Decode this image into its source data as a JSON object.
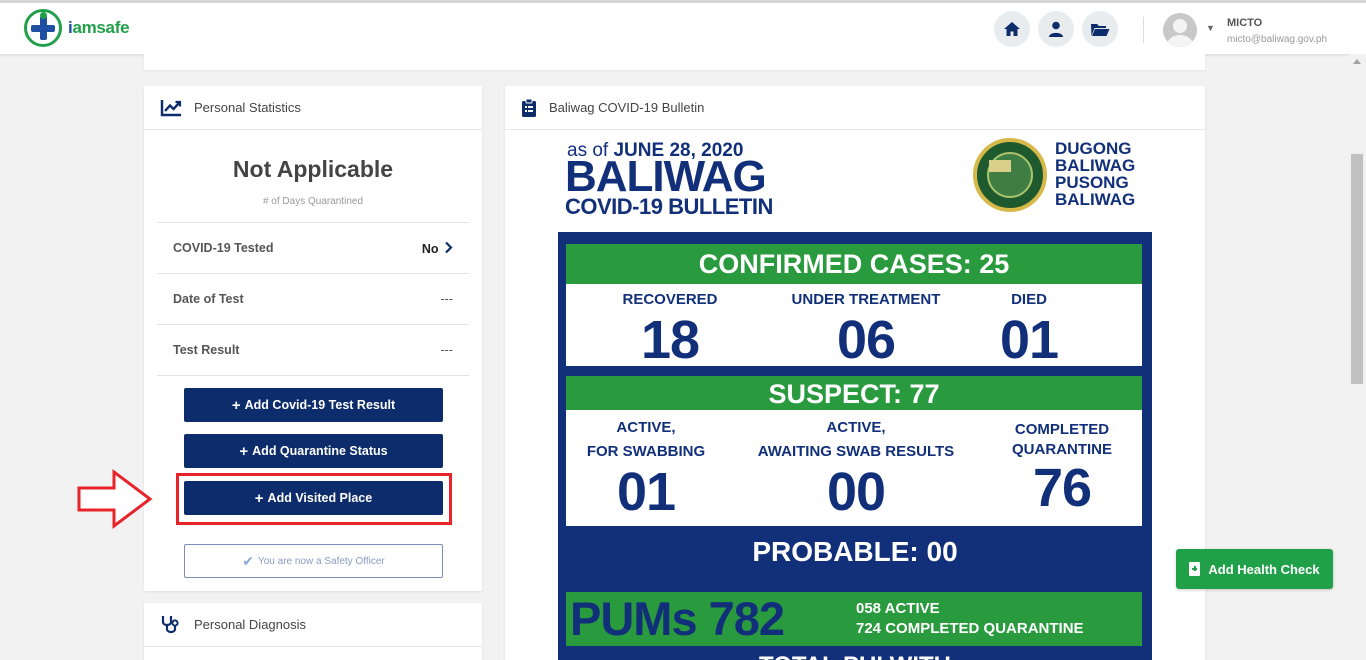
{
  "app": {
    "logo_text_a": "i",
    "logo_text_b": "amsafe"
  },
  "header": {
    "nav_icons": [
      "home-icon",
      "user-icon",
      "folder-icon"
    ],
    "user_name": "MICTO",
    "user_email": "micto@baliwag.gov.ph"
  },
  "stats_card": {
    "title": "Personal Statistics",
    "big_value": "Not Applicable",
    "big_caption": "# of Days Quarantined",
    "rows": [
      {
        "label": "COVID-19 Tested",
        "value": "No"
      },
      {
        "label": "Date of Test",
        "value": "---"
      },
      {
        "label": "Test Result",
        "value": "---"
      }
    ],
    "buttons": {
      "add_test_result": "Add Covid-19 Test Result",
      "add_quarantine": "Add Quarantine Status",
      "add_visited_place": "Add Visited Place",
      "safety_officer": "You are now a Safety Officer"
    }
  },
  "diagnosis_card": {
    "title": "Personal Diagnosis"
  },
  "bulletin_card": {
    "title": "Baliwag COVID-19 Bulletin",
    "graphic": {
      "as_of_prefix": "as of",
      "as_of_date": "JUNE 28, 2020",
      "town": "BALIWAG",
      "subtitle": "COVID-19 BULLETIN",
      "slogan": [
        "DUGONG",
        "BALIWAG",
        "PUSONG",
        "BALIWAG"
      ],
      "confirmed": "CONFIRMED CASES: 25",
      "confirmed_cols": [
        {
          "label": "RECOVERED",
          "value": "18"
        },
        {
          "label": "UNDER TREATMENT",
          "value": "06"
        },
        {
          "label": "DIED",
          "value": "01"
        }
      ],
      "suspect": "SUSPECT: 77",
      "suspect_cols": [
        {
          "label1": "ACTIVE,",
          "label2": "FOR SWABBING",
          "value": "01"
        },
        {
          "label1": "ACTIVE,",
          "label2": "AWAITING SWAB RESULTS",
          "value": "00"
        },
        {
          "label1": "COMPLETED",
          "label2": "QUARANTINE",
          "value": "76"
        }
      ],
      "probable": "PROBABLE: 00",
      "pums": "PUMs 782",
      "pums_active": "058  ACTIVE",
      "pums_completed": "724  COMPLETED QUARANTINE",
      "total_pui": "TOTAL PUI WITH"
    }
  },
  "health_check_button": "Add Health Check",
  "colors": {
    "primary": "#0d2c6b",
    "green": "#21a04a",
    "highlight": "#e8232a"
  }
}
